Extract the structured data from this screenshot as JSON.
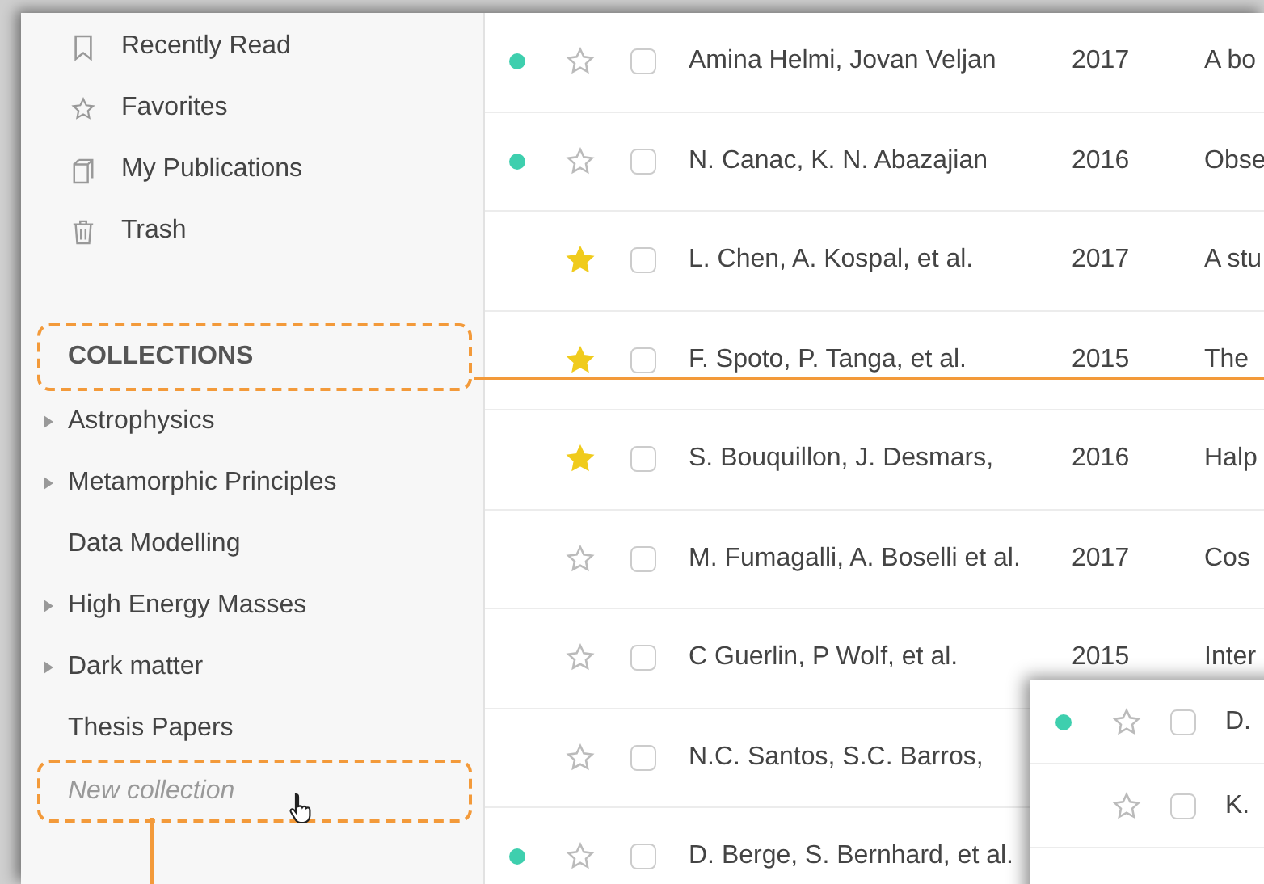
{
  "sidebar": {
    "nav_items": [
      {
        "label": "Recently Read"
      },
      {
        "label": "Favorites"
      },
      {
        "label": "My Publications"
      },
      {
        "label": "Trash"
      }
    ],
    "collections_heading": "COLLECTIONS",
    "collections": [
      {
        "label": "Astrophysics",
        "expandable": true
      },
      {
        "label": "Metamorphic Principles",
        "expandable": true
      },
      {
        "label": "Data Modelling",
        "expandable": false
      },
      {
        "label": "High Energy Masses",
        "expandable": true
      },
      {
        "label": "Dark matter",
        "expandable": true
      },
      {
        "label": "Thesis Papers",
        "expandable": false
      }
    ],
    "new_collection": {
      "placeholder": "New collection"
    }
  },
  "papers": [
    {
      "unread": true,
      "starred": false,
      "checked": false,
      "authors": "Amina Helmi, Jovan Veljan",
      "year": "2017",
      "title": "A bo"
    },
    {
      "unread": true,
      "starred": false,
      "checked": false,
      "authors": "N. Canac, K. N. Abazajian",
      "year": "2016",
      "title": "Obse"
    },
    {
      "unread": false,
      "starred": true,
      "checked": false,
      "authors": "L. Chen, A. Kospal, et al.",
      "year": "2017",
      "title": "A stu"
    },
    {
      "unread": false,
      "starred": true,
      "checked": false,
      "authors": "F. Spoto, P. Tanga, et al.",
      "year": "2015",
      "title": "The"
    },
    {
      "unread": false,
      "starred": true,
      "checked": false,
      "authors": "S. Bouquillon, J. Desmars,",
      "year": "2016",
      "title": "Halp"
    },
    {
      "unread": false,
      "starred": false,
      "checked": false,
      "authors": "M. Fumagalli, A. Boselli et al.",
      "year": "2017",
      "title": "Cos"
    },
    {
      "unread": false,
      "starred": false,
      "checked": false,
      "authors": "C Guerlin, P Wolf, et al.",
      "year": "2015",
      "title": "Inter"
    },
    {
      "unread": false,
      "starred": false,
      "checked": false,
      "authors": "N.C. Santos, S.C. Barros,"
    },
    {
      "unread": true,
      "starred": false,
      "checked": false,
      "authors": "D. Berge, S. Bernhard, et al."
    }
  ],
  "floating_panel": {
    "rows": [
      {
        "unread": true,
        "starred": false,
        "checked": false,
        "authors": "D."
      },
      {
        "unread": false,
        "starred": false,
        "checked": false,
        "authors": "K."
      }
    ]
  }
}
